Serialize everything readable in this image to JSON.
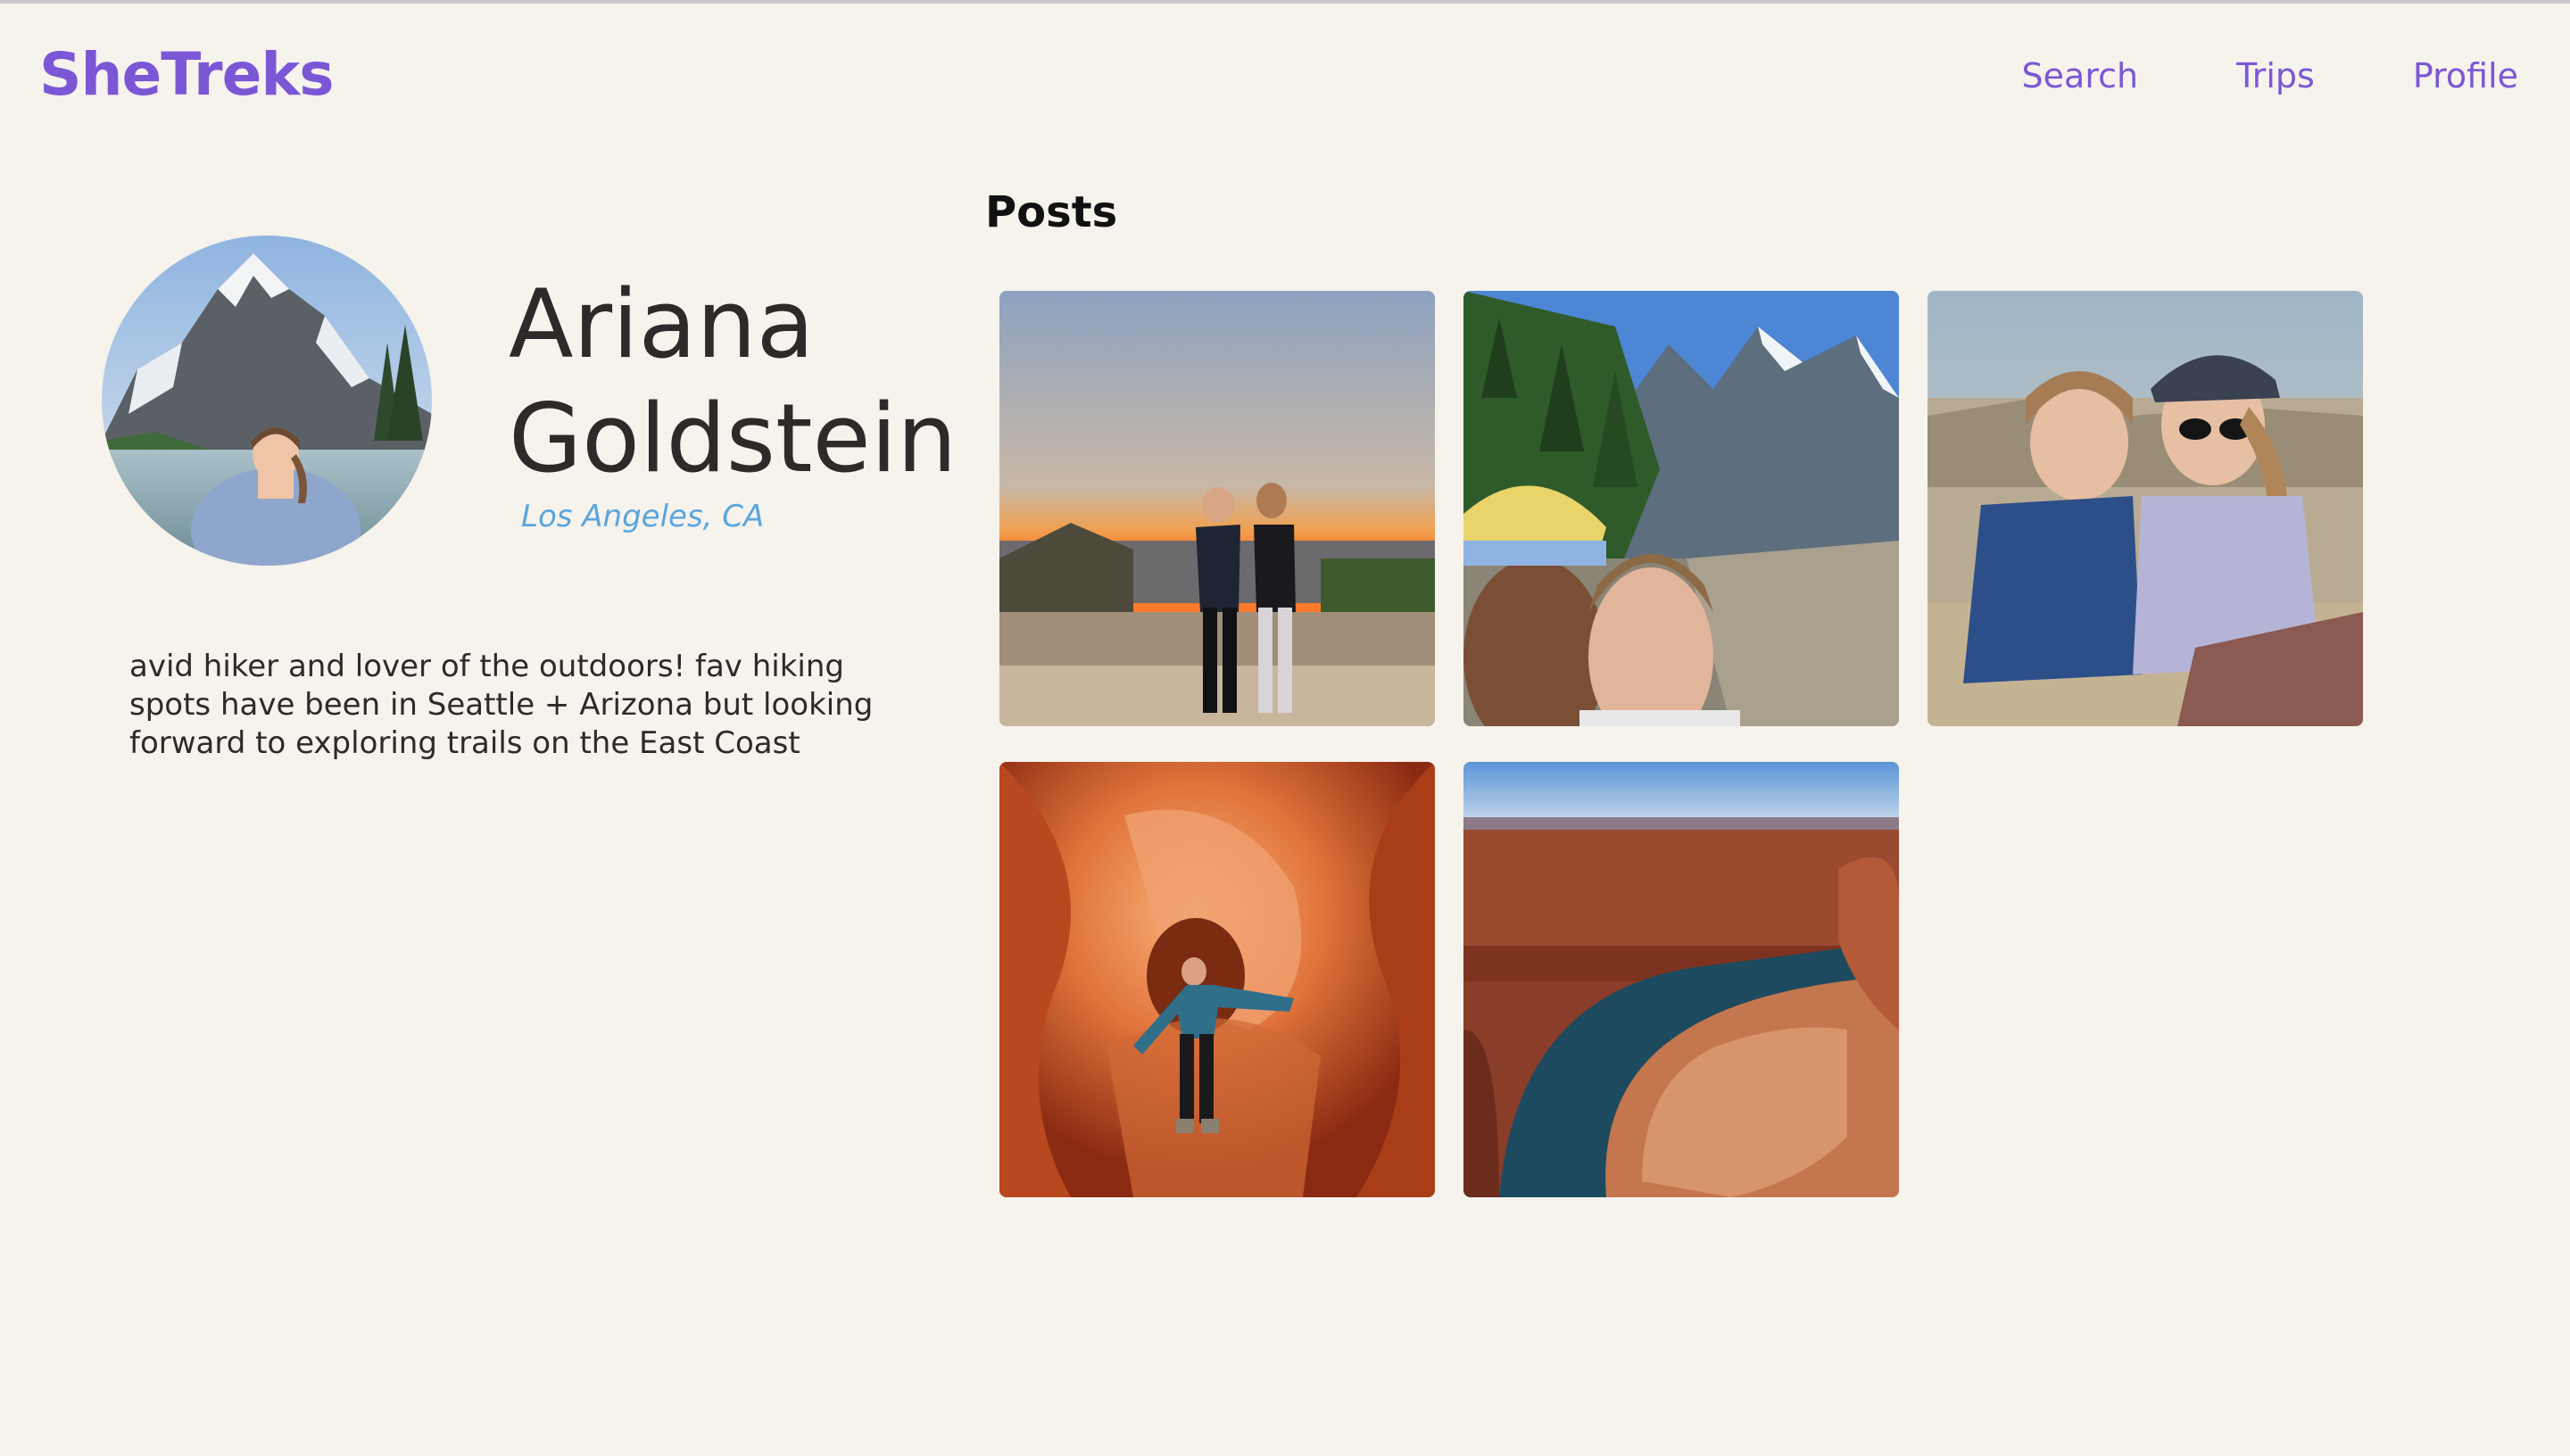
{
  "app": {
    "logo": "SheTreks"
  },
  "nav": {
    "items": [
      {
        "label": "Search"
      },
      {
        "label": "Trips"
      },
      {
        "label": "Profile"
      }
    ]
  },
  "profile": {
    "name": "Ariana Goldstein",
    "location": "Los Angeles, CA",
    "bio": "avid hiker and lover of the outdoors! fav hiking spots have been in Seattle + Arizona but looking forward to exploring trails on the East Coast"
  },
  "posts": {
    "heading": "Posts"
  },
  "colors": {
    "background": "#f6f2ec",
    "brand": "#7b57d6",
    "location": "#5aa6dd",
    "text": "#2f2a2a"
  }
}
